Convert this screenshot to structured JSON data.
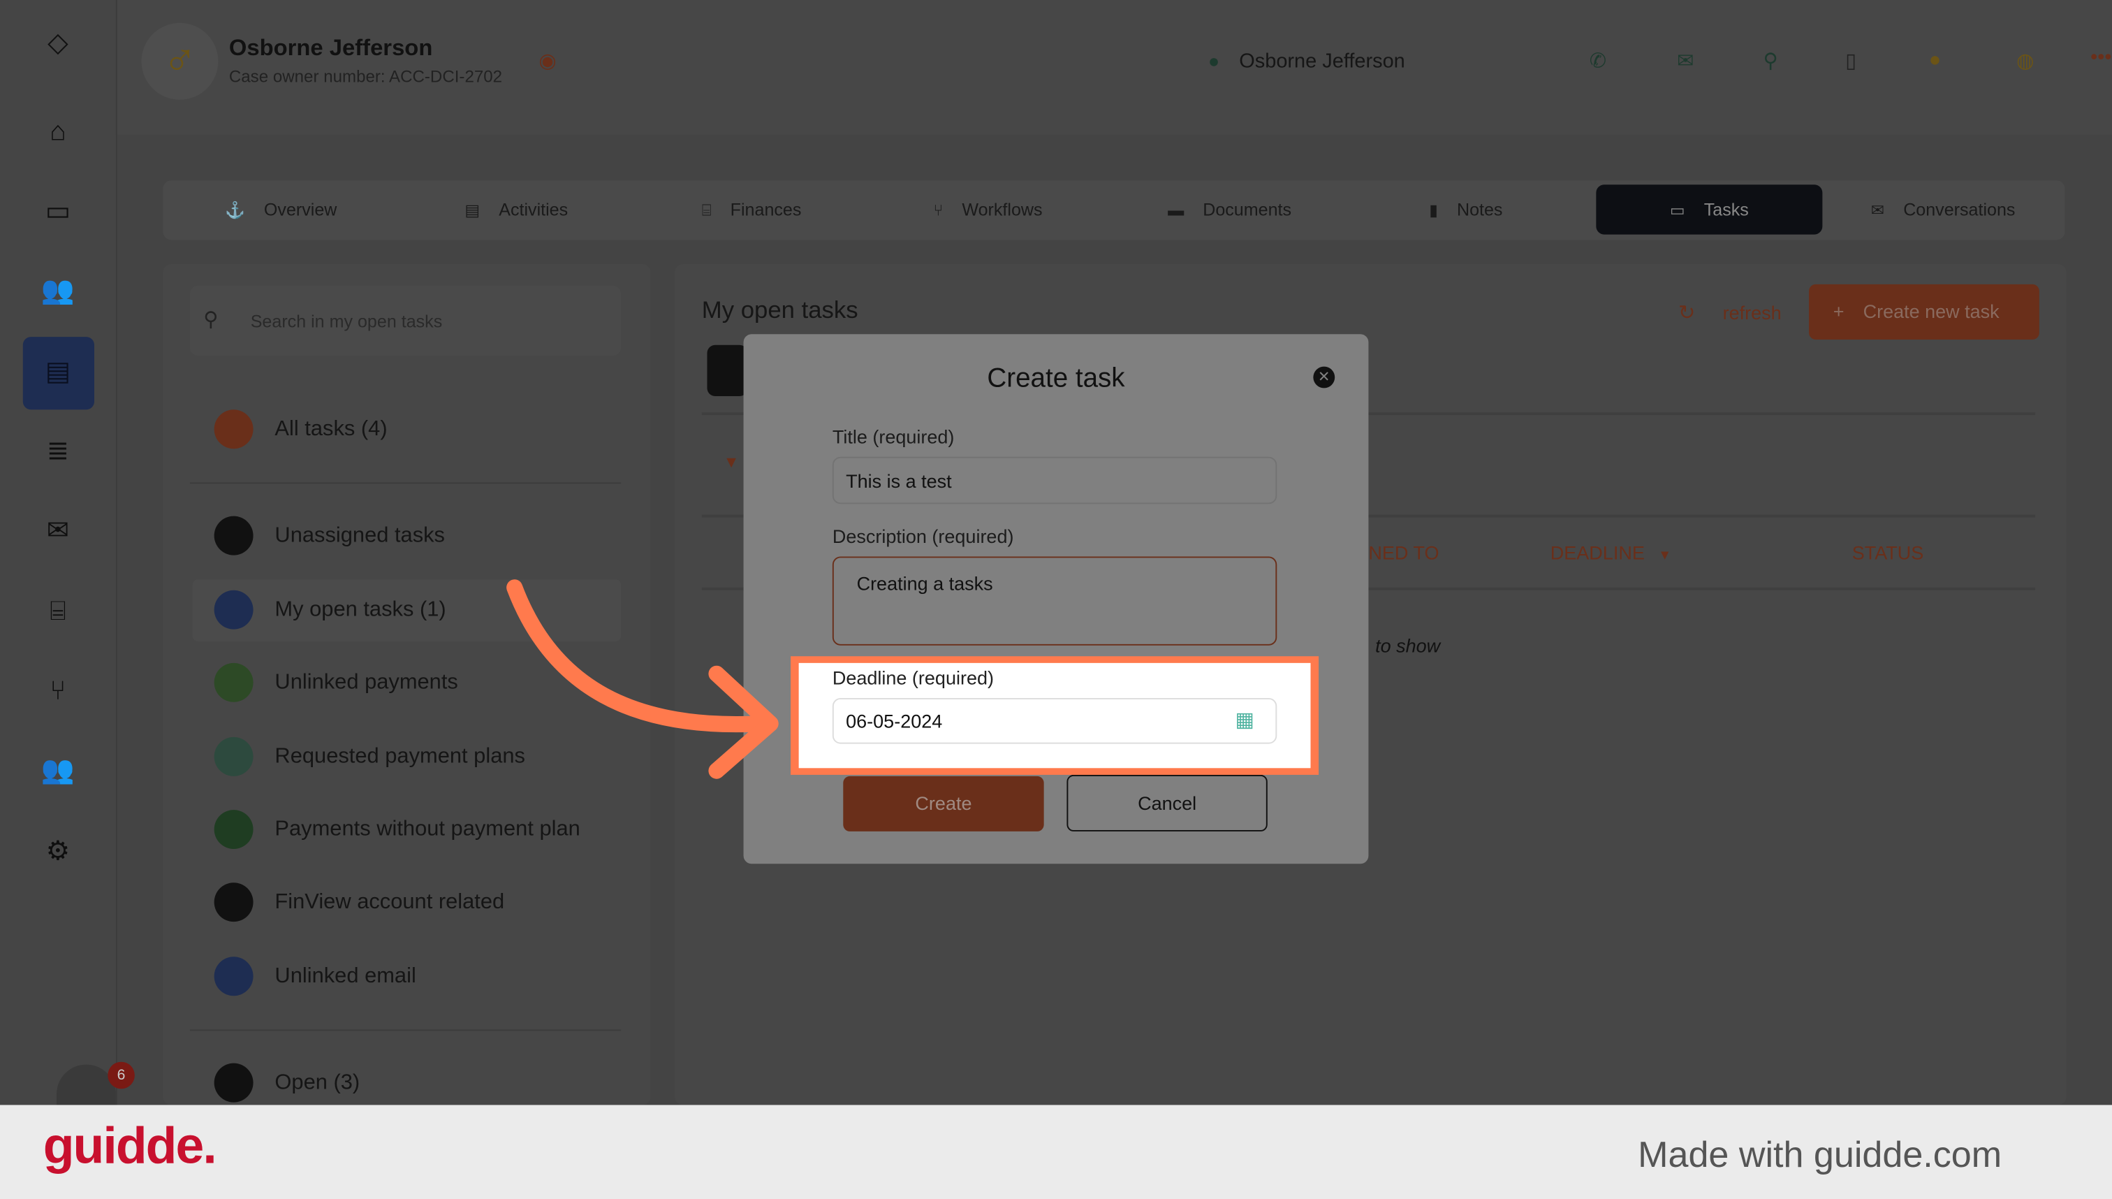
{
  "header": {
    "name": "Osborne Jefferson",
    "case_owner": "Case owner number: ACC-DCI-2702",
    "user_name": "Osborne Jefferson"
  },
  "tabs": [
    {
      "label": "Overview"
    },
    {
      "label": "Activities"
    },
    {
      "label": "Finances"
    },
    {
      "label": "Workflows"
    },
    {
      "label": "Documents"
    },
    {
      "label": "Notes"
    },
    {
      "label": "Tasks",
      "active": true
    },
    {
      "label": "Conversations"
    }
  ],
  "left": {
    "search_placeholder": "Search in my open tasks",
    "items": [
      {
        "label": "All tasks (4)",
        "color": "#6a2f1a"
      },
      {
        "label": "Unassigned tasks",
        "color": "#111"
      },
      {
        "label": "My open tasks (1)",
        "color": "#1e2d52"
      },
      {
        "label": "Unlinked payments",
        "color": "#2d4a26"
      },
      {
        "label": "Requested payment plans",
        "color": "#2d4a3e"
      },
      {
        "label": "Payments without payment plan",
        "color": "#1f3d22"
      },
      {
        "label": "FinView account related",
        "color": "#111"
      },
      {
        "label": "Unlinked email",
        "color": "#1e2d52"
      },
      {
        "label": "Open (3)",
        "color": "#111"
      }
    ]
  },
  "main": {
    "title": "My open tasks",
    "refresh": "refresh",
    "create_new": "Create new task",
    "col_assigned": "NED TO",
    "col_deadline": "DEADLINE",
    "col_status": "STATUS",
    "empty": "to show"
  },
  "modal": {
    "title": "Create task",
    "title_label": "Title (required)",
    "title_value": "This is a test",
    "desc_label": "Description (required)",
    "desc_value": "Creating a tasks",
    "deadline_label": "Deadline (required)",
    "deadline_value": "06-05-2024",
    "create": "Create",
    "cancel": "Cancel"
  },
  "badge_count": "6",
  "footer": {
    "logo": "guidde.",
    "made_with": "Made with guidde.com"
  },
  "colors": {
    "accent": "#ff7a4d",
    "brand_red": "#c8102e"
  }
}
